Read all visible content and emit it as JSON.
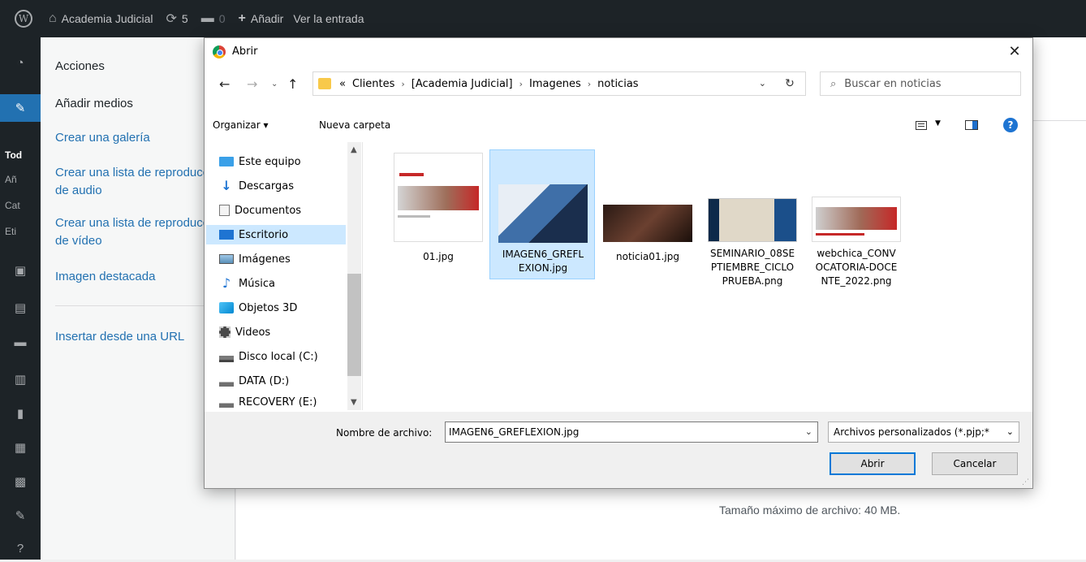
{
  "adminbar": {
    "site_name": "Academia Judicial",
    "updates_count": "5",
    "comments_count": "0",
    "add_label": "Añadir",
    "view_entry_label": "Ver la entrada"
  },
  "adminmenu": {
    "sub_labels": [
      "Tod",
      "Añ",
      "Cat",
      "Eti"
    ]
  },
  "media_sidebar": {
    "actions_heading": "Acciones",
    "add_media": "Añadir medios",
    "create_gallery": "Crear una galería",
    "create_audio_playlist": "Crear una lista de reproducción de audio",
    "create_video_playlist": "Crear una lista de reproducción de vídeo",
    "featured_image": "Imagen destacada",
    "insert_from_url": "Insertar desde una URL"
  },
  "media_main": {
    "max_size": "Tamaño máximo de archivo: 40 MB."
  },
  "dialog": {
    "title": "Abrir",
    "address": {
      "prefix": "«",
      "crumbs": [
        "Clientes",
        "[Academia Judicial]",
        "Imagenes",
        "noticias"
      ]
    },
    "search_placeholder": "Buscar en noticias",
    "organize_label": "Organizar ▾",
    "new_folder_label": "Nueva carpeta",
    "tree": [
      {
        "label": "Este equipo",
        "icon": "computer-icon"
      },
      {
        "label": "Descargas",
        "icon": "download-icon"
      },
      {
        "label": "Documentos",
        "icon": "documents-icon"
      },
      {
        "label": "Escritorio",
        "icon": "desktop-icon"
      },
      {
        "label": "Imágenes",
        "icon": "pictures-icon"
      },
      {
        "label": "Música",
        "icon": "music-icon"
      },
      {
        "label": "Objetos 3D",
        "icon": "3d-objects-icon"
      },
      {
        "label": "Videos",
        "icon": "videos-icon"
      },
      {
        "label": "Disco local (C:)",
        "icon": "local-disk-icon"
      },
      {
        "label": "DATA (D:)",
        "icon": "drive-icon"
      },
      {
        "label": "RECOVERY (E:)",
        "icon": "drive-icon"
      }
    ],
    "tree_selected_index": 3,
    "files": [
      {
        "name": "01.jpg"
      },
      {
        "name": "IMAGEN6_GREFLEXION.jpg",
        "name_lines": [
          "IMAGEN6_GREFL",
          "EXION.jpg"
        ]
      },
      {
        "name": "noticia01.jpg"
      },
      {
        "name": "SEMINARIO_08SEPTIEMBRE_CICLOPRUEBA.png",
        "name_lines": [
          "SEMINARIO_08SE",
          "PTIEMBRE_CICLO",
          "PRUEBA.png"
        ]
      },
      {
        "name": "webchica_CONVOCATORIA-DOCENTE_2022.png",
        "name_lines": [
          "webchica_CONV",
          "OCATORIA-DOCE",
          "NTE_2022.png"
        ]
      }
    ],
    "selected_file_index": 1,
    "filename_label": "Nombre de archivo:",
    "filename_value": "IMAGEN6_GREFLEXION.jpg",
    "filetype_value": "Archivos personalizados (*.pjp;*",
    "open_label": "Abrir",
    "cancel_label": "Cancelar"
  },
  "colors": {
    "wp_dark": "#1d2327",
    "wp_blue": "#2271b1",
    "selection": "#cce8ff"
  }
}
